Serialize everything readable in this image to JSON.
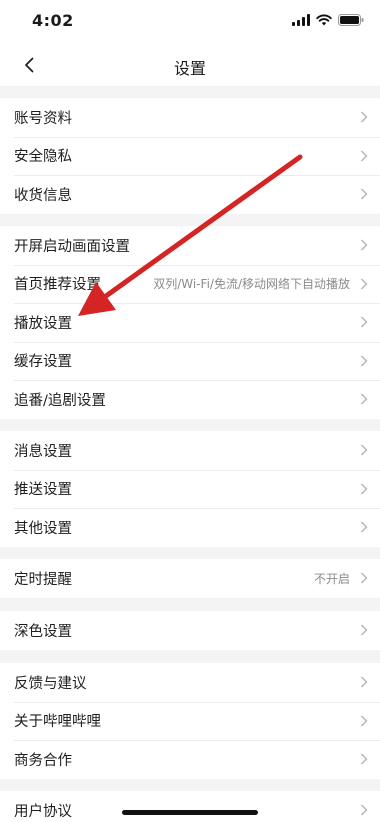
{
  "status_bar": {
    "time": "4:02"
  },
  "header": {
    "title": "设置",
    "back_icon": "chevron-left-icon"
  },
  "sections": [
    [
      {
        "label": "账号资料"
      },
      {
        "label": "安全隐私"
      },
      {
        "label": "收货信息"
      }
    ],
    [
      {
        "label": "开屏启动画面设置"
      },
      {
        "label": "首页推荐设置",
        "value": "双列/Wi-Fi/免流/移动网络下自动播放"
      },
      {
        "label": "播放设置"
      },
      {
        "label": "缓存设置"
      },
      {
        "label": "追番/追剧设置"
      }
    ],
    [
      {
        "label": "消息设置"
      },
      {
        "label": "推送设置"
      },
      {
        "label": "其他设置"
      }
    ],
    [
      {
        "label": "定时提醒",
        "value": "不开启"
      }
    ],
    [
      {
        "label": "深色设置"
      }
    ],
    [
      {
        "label": "反馈与建议"
      },
      {
        "label": "关于哔哩哔哩"
      },
      {
        "label": "商务合作"
      }
    ],
    [
      {
        "label": "用户协议"
      }
    ]
  ],
  "colors": {
    "annotation_arrow": "#d42424",
    "background": "#f4f4f4",
    "row_background": "#ffffff"
  }
}
